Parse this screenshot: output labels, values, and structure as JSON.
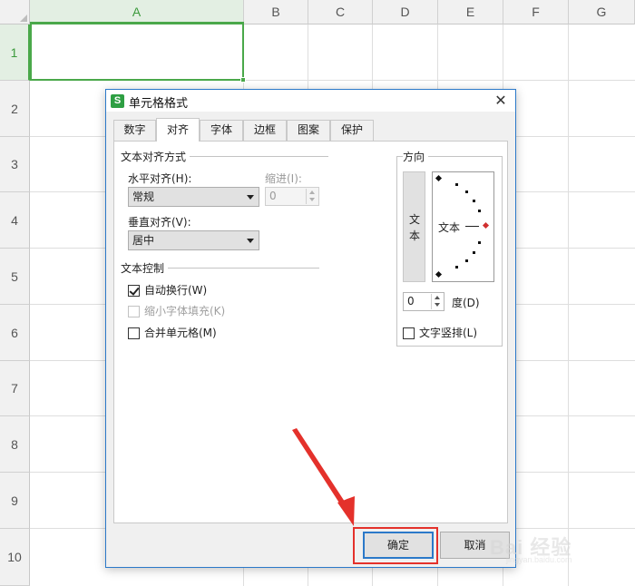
{
  "sheet": {
    "columns": [
      "A",
      "B",
      "C",
      "D",
      "E",
      "F",
      "G"
    ],
    "rows": [
      "1",
      "2",
      "3",
      "4",
      "5",
      "6",
      "7",
      "8",
      "9",
      "10"
    ],
    "active_column": "A",
    "active_row": "1",
    "selection_color": "#4aa84a"
  },
  "dialog": {
    "app_icon": "S",
    "title": "单元格格式",
    "close": "✕",
    "tabs": [
      {
        "label": "数字"
      },
      {
        "label": "对齐",
        "active": true
      },
      {
        "label": "字体"
      },
      {
        "label": "边框"
      },
      {
        "label": "图案"
      },
      {
        "label": "保护"
      }
    ],
    "alignment": {
      "group": "文本对齐方式",
      "horizontal_label": "水平对齐(H):",
      "horizontal_value": "常规",
      "indent_label": "缩进(I):",
      "indent_value": "0",
      "vertical_label": "垂直对齐(V):",
      "vertical_value": "居中"
    },
    "control": {
      "group": "文本控制",
      "wrap_text": {
        "label": "自动换行(W)",
        "checked": true
      },
      "shrink_to_fit": {
        "label": "缩小字体填充(K)",
        "checked": false,
        "disabled": true
      },
      "merge_cells": {
        "label": "合并单元格(M)",
        "checked": false
      }
    },
    "orientation": {
      "group": "方向",
      "vertical_char_1": "文",
      "vertical_char_2": "本",
      "dial_text": "文本",
      "degrees_value": "0",
      "degrees_label": "度(D)",
      "vertical_text": {
        "label": "文字竖排(L)",
        "checked": false
      }
    },
    "ok_label": "确定",
    "cancel_label": "取消"
  },
  "annotation": {
    "highlight_color": "#e4312b"
  },
  "watermark": {
    "text": "Bai 经验",
    "sub": "jingyan.baidu.com"
  }
}
